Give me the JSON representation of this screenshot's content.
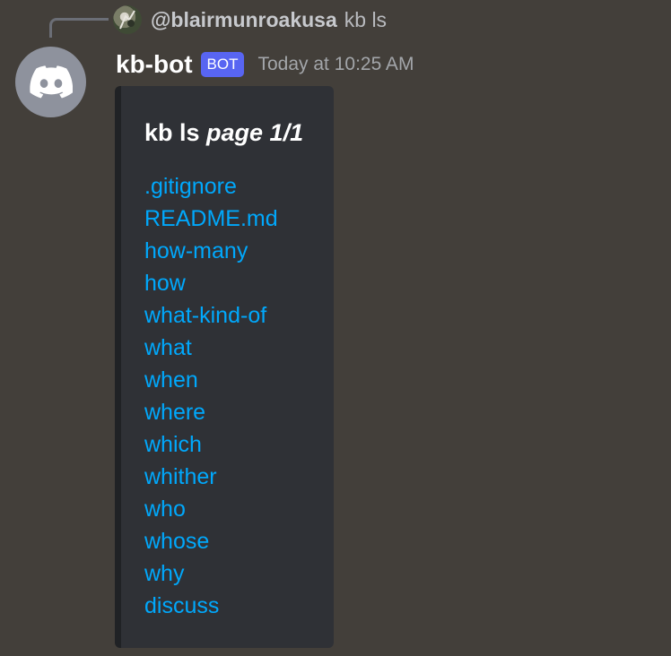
{
  "reply": {
    "username": "@blairmunroakusa",
    "text": "kb ls"
  },
  "message": {
    "author": "kb-bot",
    "badge": "BOT",
    "timestamp": "Today at 10:25 AM",
    "avatar_icon": "discord-logo-icon"
  },
  "embed": {
    "title_plain": "kb ls ",
    "title_italic": "page 1/1",
    "items": [
      ".gitignore",
      "README.md",
      "how-many",
      "how",
      "what-kind-of",
      "what",
      "when",
      "where",
      "which",
      "whither",
      "who",
      "whose",
      "why",
      "discuss"
    ]
  },
  "colors": {
    "background": "#433f3a",
    "embed_bg": "#2f3136",
    "link": "#00a8fc",
    "bot_badge": "#5865f2",
    "avatar_bg": "#8e929d"
  }
}
